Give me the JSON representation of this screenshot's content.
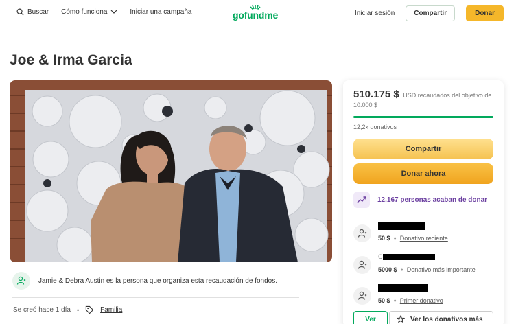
{
  "header": {
    "search_label": "Buscar",
    "how_it_works_label": "Cómo funciona",
    "start_campaign_label": "Iniciar una campaña",
    "logo_text": "gofundme",
    "signin_label": "Iniciar sesión",
    "share_label": "Compartir",
    "donate_label": "Donar"
  },
  "campaign": {
    "title": "Joe & Irma Garcia",
    "organizer_text": "Jamie & Debra Austin es la persona que organiza esta recaudación de fondos.",
    "created_text": "Se creó hace 1 día",
    "category": "Familia"
  },
  "sidebar": {
    "raised_amount": "510.175 $",
    "raised_suffix": "USD recaudados del objetivo de 10.000 $",
    "progress_fraction": 1.0,
    "donations_count": "12,2k donativos",
    "share_button": "Compartir",
    "donate_button": "Donar ahora",
    "recent_text": "12.167 personas acaban de donar",
    "donors": [
      {
        "amount": "50 $",
        "label": "Donativo reciente"
      },
      {
        "amount": "5000 $",
        "label": "Donativo más importante",
        "initial": "C"
      },
      {
        "amount": "50 $",
        "label": "Primer donativo"
      }
    ],
    "see_button": "Ver",
    "see_all_button": "Ver los donativos más"
  },
  "colors": {
    "brand_green": "#02a95c",
    "donate_yellow": "#f5b72a",
    "purple_text": "#6b3fa0"
  }
}
